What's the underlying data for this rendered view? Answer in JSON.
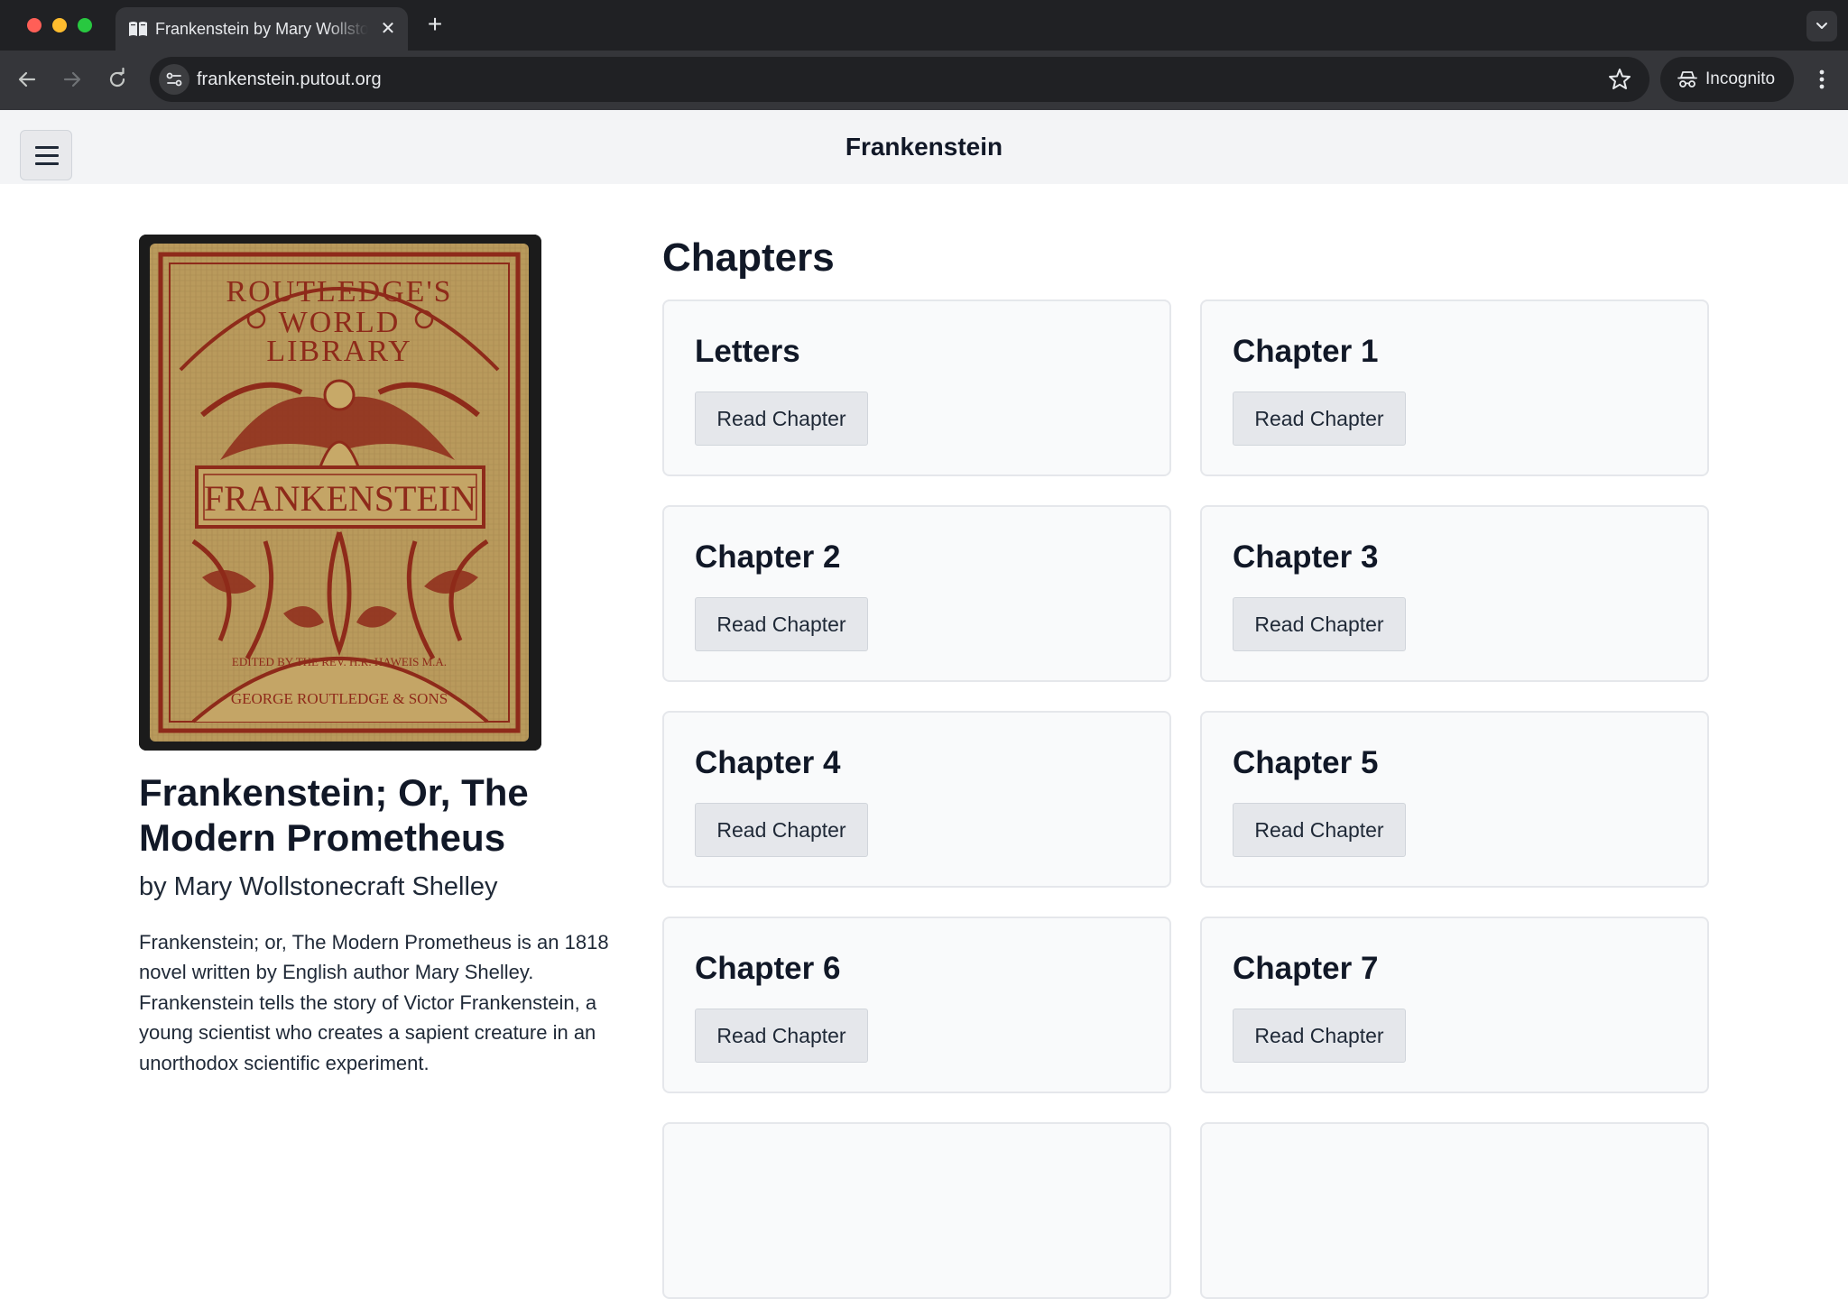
{
  "browser": {
    "tab_title": "Frankenstein by Mary Wollstonecraft Shelley",
    "tab_close": "✕",
    "new_tab": "+",
    "url": "frankenstein.putout.org",
    "incognito_label": "Incognito",
    "colors": {
      "frame": "#202124",
      "toolbar": "#35363a"
    },
    "icons": [
      "back-icon",
      "forward-icon",
      "reload-icon",
      "site-info-icon",
      "star-icon",
      "incognito-icon",
      "more-vert-icon"
    ]
  },
  "site": {
    "title": "Frankenstein",
    "menu_icon": "hamburger-icon"
  },
  "book": {
    "cover_lines": {
      "publisher_top": [
        "ROUTLEDGE'S",
        "WORLD",
        "LIBRARY"
      ],
      "title": "FRANKENSTEIN",
      "editor": "EDITED BY THE REV. H.R. HAWEIS M.A.",
      "publisher_bottom": "GEORGE ROUTLEDGE & SONS"
    },
    "title": "Frankenstein; Or, The Modern Prometheus",
    "author": "by Mary Wollstonecraft Shelley",
    "description": "Frankenstein; or, The Modern Prometheus is an 1818 novel written by English author Mary Shelley. Frankenstein tells the story of Victor Frankenstein, a young scientist who creates a sapient creature in an unorthodox scientific experiment."
  },
  "chapters": {
    "heading": "Chapters",
    "button_label": "Read Chapter",
    "items": [
      {
        "title": "Letters"
      },
      {
        "title": "Chapter 1"
      },
      {
        "title": "Chapter 2"
      },
      {
        "title": "Chapter 3"
      },
      {
        "title": "Chapter 4"
      },
      {
        "title": "Chapter 5"
      },
      {
        "title": "Chapter 6"
      },
      {
        "title": "Chapter 7"
      }
    ]
  }
}
